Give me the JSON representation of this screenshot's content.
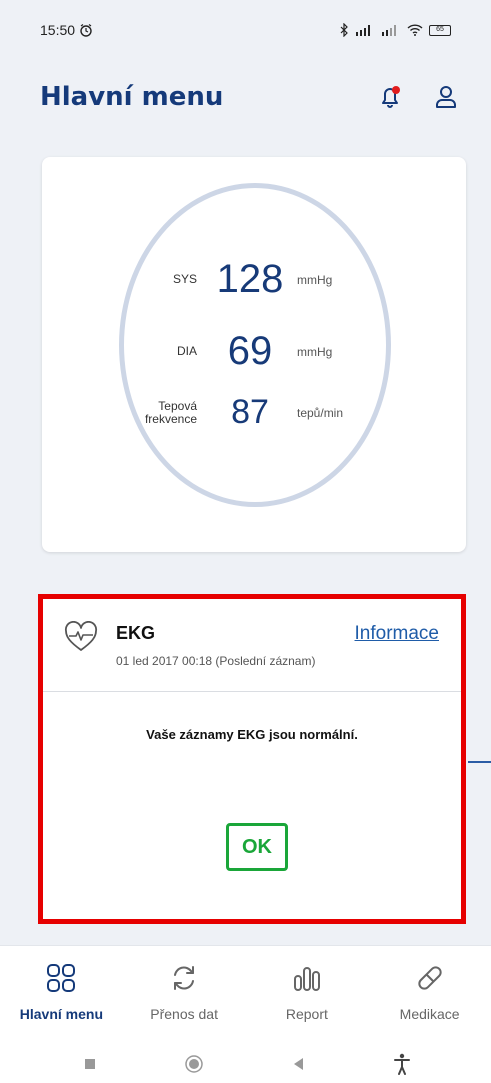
{
  "status_bar": {
    "time": "15:50",
    "battery": "65"
  },
  "header": {
    "title": "Hlavní menu"
  },
  "blood_pressure": {
    "sys": {
      "label": "SYS",
      "value": "128",
      "unit": "mmHg"
    },
    "dia": {
      "label": "DIA",
      "value": "69",
      "unit": "mmHg"
    },
    "pulse": {
      "label_line1": "Tepová",
      "label_line2": "frekvence",
      "value": "87",
      "unit": "tepů/min"
    }
  },
  "ekg": {
    "title": "EKG",
    "date": "01 led 2017 00:18 (Poslední záznam)",
    "info_link": "Informace",
    "status": "Vaše záznamy EKG jsou normální.",
    "ok_label": "OK",
    "highlight_color": "#e60000",
    "ok_color": "#1aa639"
  },
  "tabs": [
    {
      "label": "Hlavní menu",
      "icon": "grid-icon",
      "active": true
    },
    {
      "label": "Přenos dat",
      "icon": "sync-icon",
      "active": false
    },
    {
      "label": "Report",
      "icon": "report-icon",
      "active": false
    },
    {
      "label": "Medikace",
      "icon": "pill-icon",
      "active": false
    }
  ],
  "colors": {
    "primary": "#153a7a",
    "link": "#1f5ca8",
    "background": "#eef1f6",
    "notification_dot": "#e11d1d"
  }
}
